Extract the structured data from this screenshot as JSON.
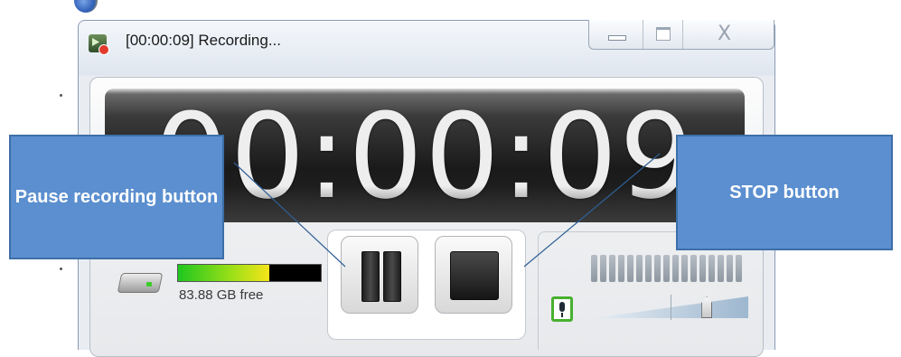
{
  "window": {
    "title": "[00:00:09] Recording...",
    "close_glyph": "X"
  },
  "timer": {
    "display": "00:00:09"
  },
  "disk": {
    "free_label": "83.88 GB free",
    "usage_fraction": 0.64
  },
  "volume": {
    "level_fraction": 0.77,
    "ticks": 17
  },
  "icons": {
    "app": "recorder-app-icon",
    "disk": "hard-drive-icon",
    "mic": "microphone-icon"
  },
  "annotations": {
    "pause_callout": "Pause recording button",
    "stop_callout": "STOP button"
  },
  "colors": {
    "callout_fill": "#5b8fcf",
    "mic_border": "#48b02f",
    "disk_meter_green": "#1fc61f",
    "disk_meter_yellow": "#f6e41a"
  }
}
